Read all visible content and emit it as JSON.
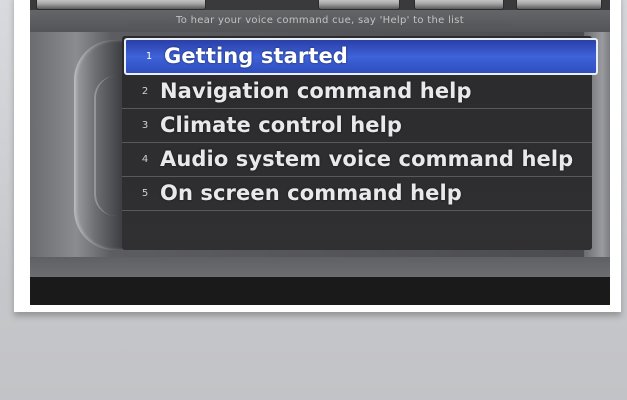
{
  "hint_text": "To hear your voice command cue, say 'Help' to the list",
  "menu": {
    "items": [
      {
        "number": "1",
        "label": "Getting started",
        "selected": true
      },
      {
        "number": "2",
        "label": "Navigation command help",
        "selected": false
      },
      {
        "number": "3",
        "label": "Climate control help",
        "selected": false
      },
      {
        "number": "4",
        "label": "Audio system voice command help",
        "selected": false
      },
      {
        "number": "5",
        "label": "On screen command help",
        "selected": false
      }
    ]
  },
  "colors": {
    "selection": "#3e62d8",
    "selection_border": "#e9eef8",
    "list_background": "#2b2b2d",
    "text": "#e9e9ec"
  }
}
